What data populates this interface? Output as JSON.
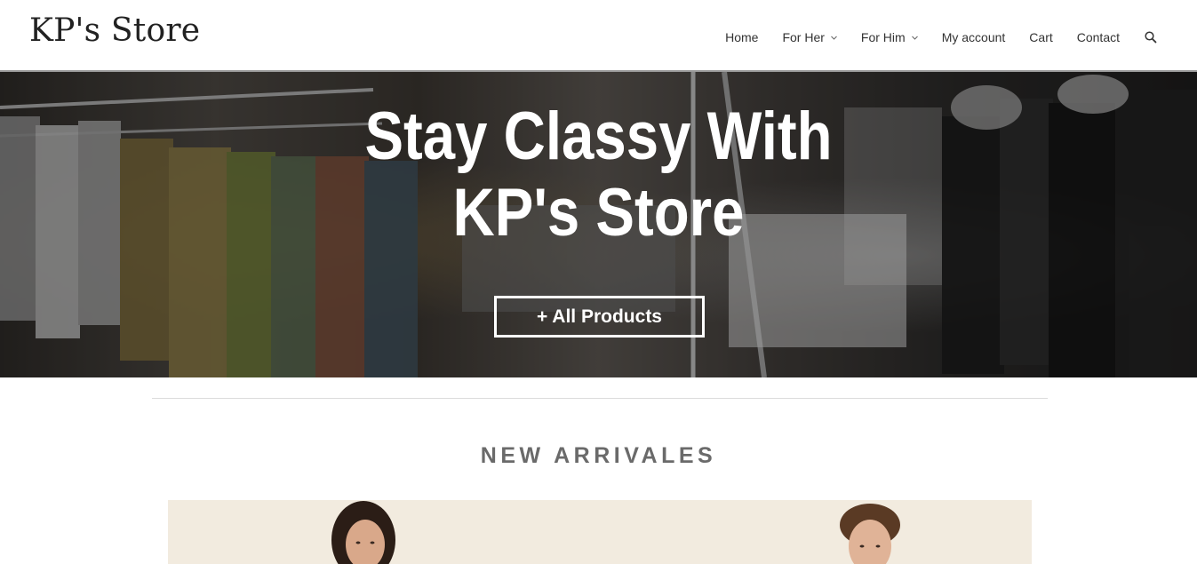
{
  "site": {
    "logo": "KP's Store"
  },
  "nav": {
    "items": [
      {
        "label": "Home",
        "dropdown": false
      },
      {
        "label": "For Her",
        "dropdown": true
      },
      {
        "label": "For Him",
        "dropdown": true
      },
      {
        "label": "My account",
        "dropdown": false
      },
      {
        "label": "Cart",
        "dropdown": false
      },
      {
        "label": "Contact",
        "dropdown": false
      }
    ],
    "search_icon": "search-icon"
  },
  "hero": {
    "title_line1": "Stay Classy With",
    "title_line2": "KP's Store",
    "button_label": "+ All Products"
  },
  "new_arrivals": {
    "heading": "NEW ARRIVALES"
  },
  "colors": {
    "header_bg": "#ffffff",
    "header_border": "#9a9a9a",
    "hero_text": "#ffffff",
    "section_heading": "#6a6a6a",
    "banner_bg": "#f2ebdf"
  }
}
